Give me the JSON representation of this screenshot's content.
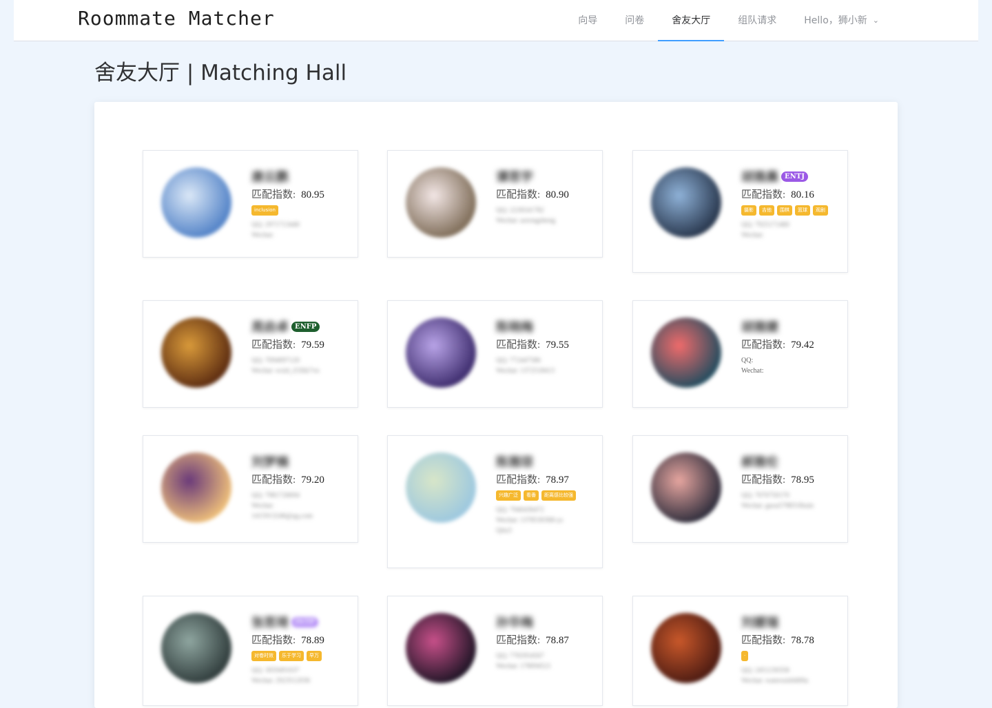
{
  "app": {
    "brand": "Roommate Matcher"
  },
  "nav": {
    "items": [
      "向导",
      "问卷",
      "舍友大厅",
      "组队请求"
    ],
    "active_index": 2,
    "user_menu": "Hello，狮小新"
  },
  "page": {
    "title": "舍友大厅 | Matching Hall",
    "score_label": "匹配指数:"
  },
  "cards": [
    {
      "name": "唐云鹏",
      "score": "80.95",
      "mbti": "",
      "tags": [
        "inclusion"
      ],
      "contact": [
        "QQ: 2971713440",
        "Wechat:"
      ],
      "avatar": [
        "#4f80c6",
        "#dbe8f7"
      ]
    },
    {
      "name": "谭思宇",
      "score": "80.90",
      "mbti": "",
      "tags": [],
      "contact": [
        "QQ: 2226541782",
        "Wechat: aorongsheng"
      ],
      "avatar": [
        "#7c6a55",
        "#f3e7e6"
      ]
    },
    {
      "name": "胡雅晨",
      "score": "80.16",
      "mbti": "ENTJ",
      "mbti_color": "#9b59e6",
      "tags": [
        "摄影",
        "吉他",
        "围棋",
        "篮球",
        "观剧"
      ],
      "contact": [
        "QQ: 7925171460",
        "Wechat:"
      ],
      "avatar": [
        "#26344a",
        "#8fb2d8"
      ]
    },
    {
      "name": "周启卓",
      "score": "79.59",
      "mbti": "ENFP",
      "mbti_color": "#1e5f2e",
      "tags": [],
      "contact": [
        "QQ: 7094097120",
        "Wechat: wxid_t53lik7vn"
      ],
      "avatar": [
        "#5a2a10",
        "#d99a3a"
      ]
    },
    {
      "name": "陈晓梅",
      "score": "79.55",
      "mbti": "",
      "tags": [],
      "contact": [
        "QQ: 772447586",
        "Wechat: 1372518413"
      ],
      "avatar": [
        "#3b2a6b",
        "#b9a4e8"
      ]
    },
    {
      "name": "胡雅婕",
      "score": "79.42",
      "mbti": "",
      "tags": [],
      "contact": [
        "QQ:",
        "Wechat:"
      ],
      "contact_clear": true,
      "avatar": [
        "#1e4c5f",
        "#f06b6b"
      ]
    },
    {
      "name": "刘梦楠",
      "score": "79.20",
      "mbti": "",
      "tags": [],
      "contact": [
        "QQ: 7981726694",
        "Wechat:",
        "1415913246@qq.com"
      ],
      "avatar": [
        "#f1c27a",
        "#6a3a7a"
      ]
    },
    {
      "name": "陈雅琼",
      "score": "78.97",
      "mbti": "",
      "tags": [
        "兴趣广泛",
        "看番",
        "距离感比较强"
      ],
      "contact": [
        "QQ: 7940436472",
        "Wechat: 1378530368-ys",
        "Qtiu3"
      ],
      "avatar": [
        "#9bc7e0",
        "#d8e6c8"
      ]
    },
    {
      "name": "郝雅伦",
      "score": "78.95",
      "mbti": "",
      "tags": [],
      "contact": [
        "QQ: 7070750170",
        "Wechat: guoa5788318rain"
      ],
      "avatar": [
        "#2b2b3a",
        "#e7a6a0"
      ]
    },
    {
      "name": "张思琦",
      "score": "78.89",
      "mbti": "INTP",
      "mbti_color": "#b48ef6",
      "mbti_blur": true,
      "tags": [
        "对卷时效",
        "乐于学习",
        "早万"
      ],
      "contact": [
        "QQ: 3059491637",
        "Wechat: 2923512036"
      ],
      "avatar": [
        "#2e3a3a",
        "#8fa6a0"
      ]
    },
    {
      "name": "孙华梅",
      "score": "78.87",
      "mbti": "",
      "tags": [],
      "contact": [
        "QQ: 7765954567",
        "Wechat: 178094521"
      ],
      "avatar": [
        "#1c1424",
        "#c8508a"
      ]
    },
    {
      "name": "刘媛瑞",
      "score": "78.78",
      "mbti": "",
      "tags": [
        "·"
      ],
      "contact": [
        "QQ: 2451230358",
        "Wechat: waterssid4400a"
      ],
      "avatar": [
        "#4a1a12",
        "#c9582a"
      ]
    }
  ]
}
